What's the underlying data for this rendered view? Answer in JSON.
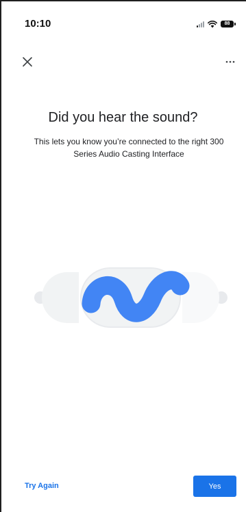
{
  "status_bar": {
    "time": "10:10",
    "battery_label": "88"
  },
  "toolbar": {
    "close_icon": "close-icon",
    "more_icon": "more-horizontal-icon"
  },
  "content": {
    "title": "Did you hear the sound?",
    "subtitle": "This lets you know you’re connected to the right 300 Series Audio Casting Interface"
  },
  "illustration": {
    "icon": "sound-wave-icon",
    "wave_color": "#4285f4",
    "shape_color": "#f1f3f4"
  },
  "actions": {
    "try_again_label": "Try Again",
    "yes_label": "Yes"
  },
  "colors": {
    "accent": "#1a73e8"
  }
}
